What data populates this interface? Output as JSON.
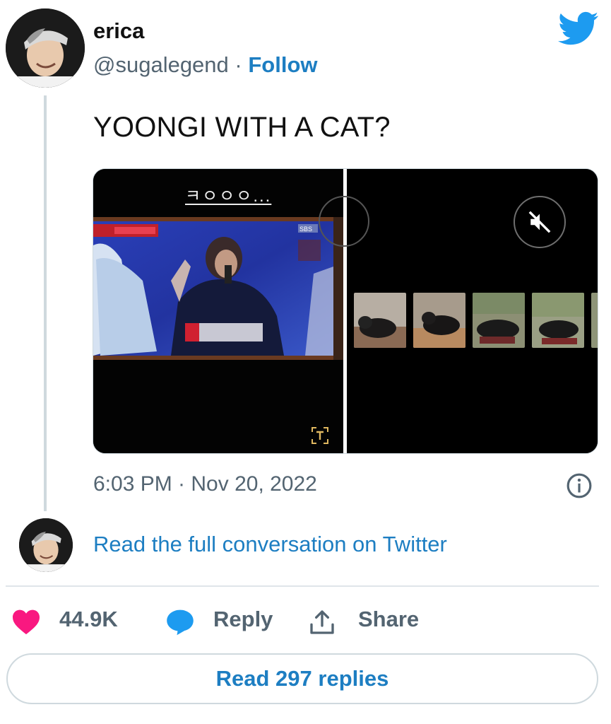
{
  "user": {
    "display_name": "erica",
    "handle": "@sugalegend",
    "separator": " · ",
    "follow_label": "Follow"
  },
  "tweet": {
    "text": "YOONGI WITH A CAT?",
    "timestamp": "6:03 PM · Nov 20, 2022"
  },
  "media": {
    "left_caption": "ㅋㅇㅇㅇ...",
    "tv_overlay_text": "SBS"
  },
  "conversation_link": "Read the full conversation on Twitter",
  "actions": {
    "like_count": "44.9K",
    "reply_label": "Reply",
    "share_label": "Share"
  },
  "read_replies_label": "Read 297 replies",
  "colors": {
    "link_blue": "#1d7ec2",
    "twitter_blue": "#1d9bf0",
    "like_pink": "#f91880",
    "muted_gray": "#536471"
  },
  "icons": [
    "twitter-bird-icon",
    "text-recognition-icon",
    "mute-icon",
    "info-icon",
    "heart-icon",
    "reply-bubble-icon",
    "share-icon"
  ]
}
